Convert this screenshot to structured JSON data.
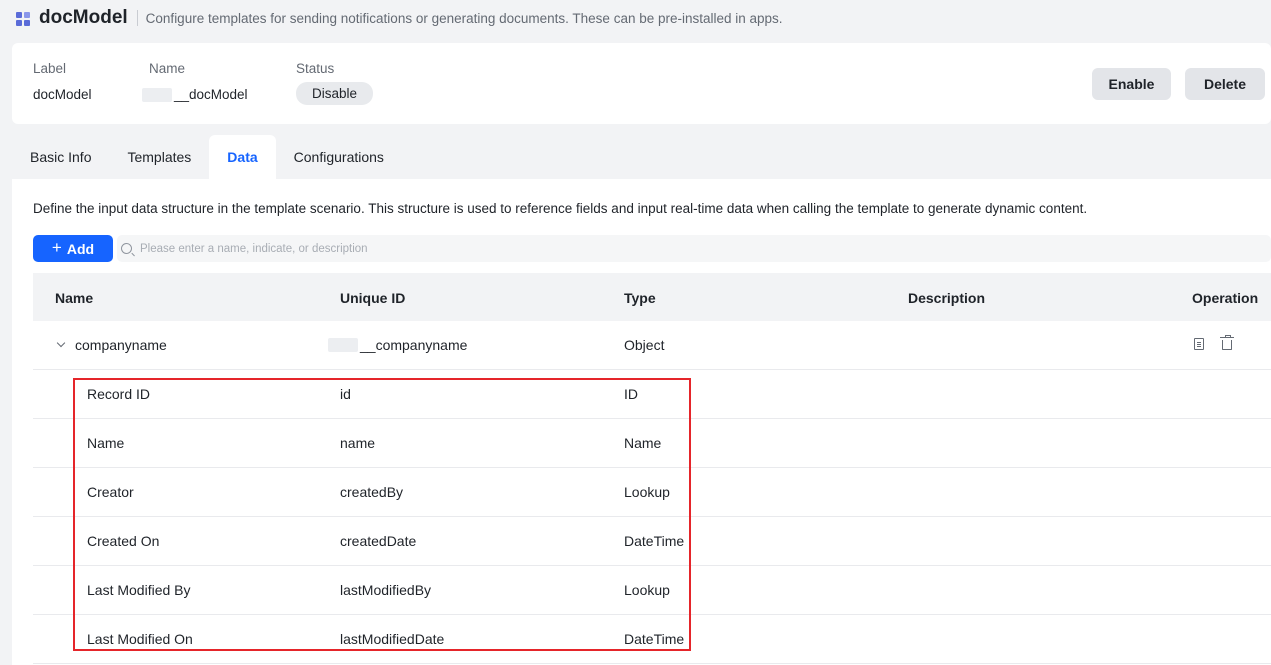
{
  "header": {
    "title": "docModel",
    "description": "Configure templates for sending notifications or generating documents. These can be pre-installed in apps."
  },
  "info": {
    "label_caption": "Label",
    "label_value": "docModel",
    "name_caption": "Name",
    "name_value": "__docModel",
    "status_caption": "Status",
    "status_value": "Disable"
  },
  "actions": {
    "enable": "Enable",
    "delete": "Delete"
  },
  "tabs": [
    {
      "label": "Basic Info"
    },
    {
      "label": "Templates"
    },
    {
      "label": "Data",
      "active": true
    },
    {
      "label": "Configurations"
    }
  ],
  "panel": {
    "description": "Define the input data structure in the template scenario. This structure is used to reference fields and input real-time data when calling the template to generate dynamic content.",
    "add_label": "Add",
    "search_placeholder": "Please enter a name, indicate, or description"
  },
  "table": {
    "columns": [
      "Name",
      "Unique ID",
      "Type",
      "Description",
      "Operation"
    ],
    "parent": {
      "name": "companyname",
      "unique_id": "__companyname",
      "type": "Object",
      "description": ""
    },
    "children": [
      {
        "name": "Record ID",
        "unique_id": "id",
        "type": "ID"
      },
      {
        "name": "Name",
        "unique_id": "name",
        "type": "Name"
      },
      {
        "name": "Creator",
        "unique_id": "createdBy",
        "type": "Lookup"
      },
      {
        "name": "Created On",
        "unique_id": "createdDate",
        "type": "DateTime"
      },
      {
        "name": "Last Modified By",
        "unique_id": "lastModifiedBy",
        "type": "Lookup"
      },
      {
        "name": "Last Modified On",
        "unique_id": "lastModifiedDate",
        "type": "DateTime"
      }
    ]
  },
  "colors": {
    "accent": "#1664ff",
    "highlight": "#e5252a",
    "page_bg": "#f2f3f5"
  }
}
